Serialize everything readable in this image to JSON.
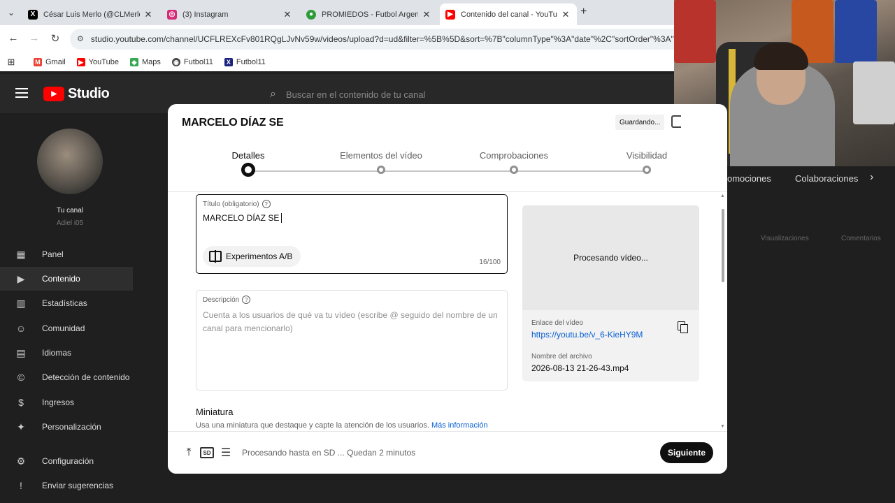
{
  "browser": {
    "tabs": [
      {
        "label": "César Luis Merlo (@CLMerlo) / X",
        "favicon": "x-icon",
        "color": "#000000",
        "active": false
      },
      {
        "label": "(3) Instagram",
        "favicon": "instagram-icon",
        "color": "#d62976",
        "active": false
      },
      {
        "label": "PROMIEDOS - Futbol Argentino",
        "favicon": "promiedos-icon",
        "color": "#2e9b3a",
        "active": false
      },
      {
        "label": "Contenido del canal - YouTube",
        "favicon": "youtube-icon",
        "color": "#ff0000",
        "active": true
      }
    ],
    "url": "studio.youtube.com/channel/UCFLREXcFv801RQgLJvNv59w/videos/upload?d=ud&filter=%5B%5D&sort=%7B\"columnType\"%3A\"date\"%2C\"sortOrder\"%3A\"DESC",
    "bookmarks": [
      {
        "label": "Gmail",
        "icon": "gmail-icon",
        "color": "#ea4335"
      },
      {
        "label": "YouTube",
        "icon": "youtube-icon",
        "color": "#ff0000"
      },
      {
        "label": "Maps",
        "icon": "maps-icon",
        "color": "#34a853"
      },
      {
        "label": "Futbol11",
        "icon": "globe-icon",
        "color": "#444444"
      },
      {
        "label": "Futbol11",
        "icon": "x-icon",
        "color": "#1a237e"
      }
    ]
  },
  "studio": {
    "logo_text": "Studio",
    "search_placeholder": "Buscar en el contenido de tu canal",
    "channel": {
      "label": "Tu canal",
      "handle": "Adiel i05"
    },
    "nav": [
      {
        "label": "Panel",
        "icon": "dashboard-icon"
      },
      {
        "label": "Contenido",
        "icon": "content-icon",
        "active": true
      },
      {
        "label": "Estadísticas",
        "icon": "analytics-icon"
      },
      {
        "label": "Comunidad",
        "icon": "community-icon"
      },
      {
        "label": "Idiomas",
        "icon": "subtitles-icon"
      },
      {
        "label": "Detección de contenido",
        "icon": "copyright-icon"
      },
      {
        "label": "Ingresos",
        "icon": "dollar-icon"
      },
      {
        "label": "Personalización",
        "icon": "magic-wand-icon"
      },
      {
        "label": "Configuración",
        "icon": "gear-icon"
      },
      {
        "label": "Enviar sugerencias",
        "icon": "feedback-icon"
      }
    ],
    "bg_tabs": [
      "omociones",
      "Colaboraciones"
    ],
    "bg_columns": [
      "Visualizaciones",
      "Comentarios"
    ]
  },
  "dialog": {
    "title": "MARCELO DÍAZ SE",
    "status_chip": "Guardando...",
    "steps": [
      {
        "label": "Detalles",
        "active": true
      },
      {
        "label": "Elementos del vídeo",
        "active": false
      },
      {
        "label": "Comprobaciones",
        "active": false
      },
      {
        "label": "Visibilidad",
        "active": false
      }
    ],
    "title_field": {
      "label": "Título (obligatorio)",
      "value": "MARCELO DÍAZ SE",
      "counter": "16/100",
      "ab_button": "Experimentos A/B"
    },
    "description_field": {
      "label": "Descripción",
      "placeholder": "Cuenta a los usuarios de qué va tu vídeo (escribe @ seguido del nombre de un canal para mencionarlo)"
    },
    "thumbnail": {
      "heading": "Miniatura",
      "subtitle": "Usa una miniatura que destaque y capte la atención de los usuarios.",
      "link": "Más información"
    },
    "preview": {
      "processing": "Procesando vídeo...",
      "link_label": "Enlace del vídeo",
      "link": "https://youtu.be/v_6-KieHY9M",
      "file_label": "Nombre del archivo",
      "file_name": "2026-08-13 21-26-43.mp4"
    },
    "footer": {
      "status": "Procesando hasta en SD ... Quedan 2 minutos",
      "sd_badge": "SD",
      "next_button": "Siguiente"
    }
  }
}
